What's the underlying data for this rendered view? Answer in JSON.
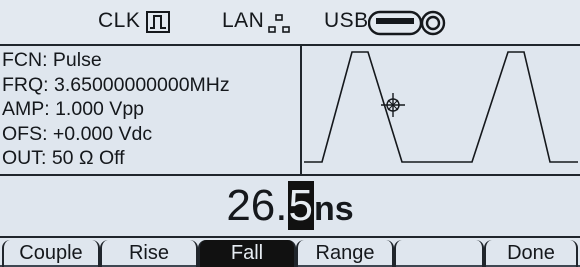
{
  "status": {
    "clk_label": "CLK",
    "lan_label": "LAN",
    "usb_label": "USB",
    "icons": [
      "clock-pulse-icon",
      "network-icon",
      "usb-drive-icon"
    ]
  },
  "info": {
    "fcn": "FCN: Pulse",
    "frq": "FRQ: 3.65000000000MHz",
    "amp": "AMP: 1.000 Vpp",
    "ofs": "OFS: +0.000 Vdc",
    "out": "OUT: 50 Ω Off"
  },
  "waveform": {
    "shape": "pulse",
    "cursor_icon": "crosshair-icon"
  },
  "editor": {
    "prefix": "26.",
    "highlight_digit": "5",
    "unit": "ns"
  },
  "softkeys": [
    {
      "label": "Couple",
      "active": false
    },
    {
      "label": "Rise",
      "active": false
    },
    {
      "label": "Fall",
      "active": true
    },
    {
      "label": "Range",
      "active": false
    },
    {
      "label": "",
      "active": false
    },
    {
      "label": "Done",
      "active": false
    }
  ]
}
